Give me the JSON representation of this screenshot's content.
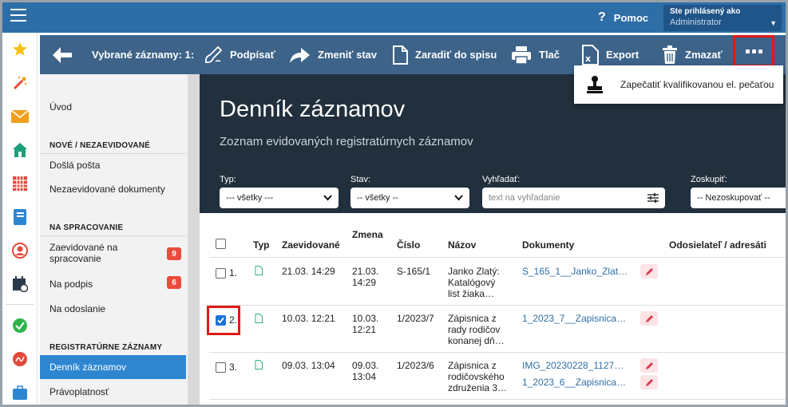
{
  "topbar": {
    "help_label": "Pomoc",
    "help_glyph": "?",
    "user_caption": "Ste prihlásený ako",
    "user_name": "Administrator"
  },
  "actionbar": {
    "selected_label": "Vybrané záznamy: 1:",
    "sign_label": "Podpísať",
    "change_state_label": "Zmeniť stav",
    "file_label": "Zaradiť do spisu",
    "print_label": "Tlač",
    "export_label": "Export",
    "delete_label": "Zmazať"
  },
  "dropdown": {
    "seal_label": "Zapečatiť kvalifikovanou el. pečaťou"
  },
  "nav": {
    "intro": "Úvod",
    "section_new": "NOVÉ / NEZAEVIDOVANÉ",
    "incoming": "Došlá pošta",
    "unregistered": "Nezaevidované dokumenty",
    "section_processing": "NA SPRACOVANIE",
    "registered_processing": "Zaevidované na spracovanie",
    "registered_processing_count": "9",
    "to_sign": "Na podpis",
    "to_sign_count": "6",
    "to_send": "Na odoslanie",
    "section_registry": "REGISTRATÚRNE ZÁZNAMY",
    "journal": "Denník záznamov",
    "validity": "Právoplatnosť"
  },
  "hero": {
    "title": "Denník záznamov",
    "subtitle": "Zoznam evidovaných registratúrnych záznamov"
  },
  "filters": {
    "type_label": "Typ:",
    "type_value": "--- všetky ---",
    "state_label": "Stav:",
    "state_value": "-- všetky --",
    "search_label": "Vyhľadať:",
    "search_placeholder": "text na vyhľadanie",
    "group_label": "Zoskupiť:",
    "group_value": "-- Nezoskupovať --"
  },
  "table": {
    "columns": {
      "type": "Typ",
      "registered": "Zaevidované",
      "change": "Zmena",
      "number": "Číslo",
      "name": "Názov",
      "documents": "Dokumenty",
      "sender": "Odosielateľ / adresáti"
    },
    "rows": [
      {
        "index": "1.",
        "registered": "21.03. 14:29",
        "change_date": "21.03.",
        "change_time": "14:29",
        "number": "S-165/1",
        "name_1": "Janko Zlatý:",
        "name_2": "Katalógový",
        "name_3": "list žiaka…",
        "doc_1": "S_165_1__Janko_Zlat…",
        "checked": false
      },
      {
        "index": "2.",
        "registered": "10.03. 12:21",
        "change_date": "10.03.",
        "change_time": "12:21",
        "number": "1/2023/7",
        "name_1": "Zápisnica z",
        "name_2": "rady rodičov",
        "name_3": "konanej dň…",
        "doc_1": "1_2023_7__Zapisnica…",
        "checked": true
      },
      {
        "index": "3.",
        "registered": "09.03. 13:04",
        "change_date": "09.03.",
        "change_time": "13:04",
        "number": "1/2023/6",
        "name_1": "Zápisnica z",
        "name_2": "rodičovského",
        "name_3": "združenia 3…",
        "doc_1": "IMG_20230228_1127…",
        "doc_2": "1_2023_6__Zapisnica…",
        "checked": false
      }
    ]
  },
  "colors": {
    "topbar": "#2e6ea6",
    "actionbar": "#3d6389",
    "hero": "#22303d",
    "nav_active": "#2e86d1",
    "badge": "#e94b3c",
    "highlight": "#e01919"
  }
}
